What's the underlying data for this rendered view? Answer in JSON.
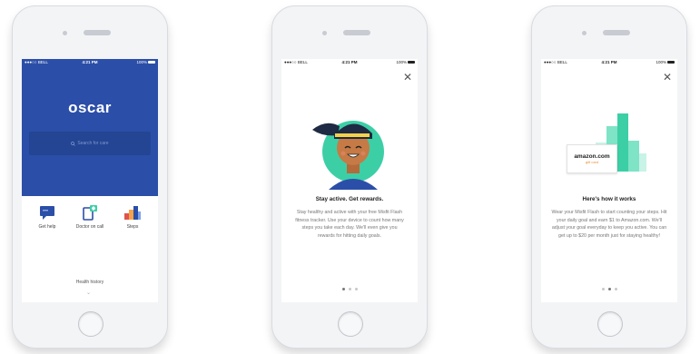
{
  "status_bar": {
    "carrier": "BELL",
    "time": "4:21 PM",
    "battery": "100%"
  },
  "home_screen": {
    "logo": "oscar",
    "search_placeholder": "Search for care",
    "tiles": [
      {
        "label": "Get help",
        "icon": "chat-icon"
      },
      {
        "label": "Doctor on call",
        "icon": "phone-call-icon"
      },
      {
        "label": "Steps",
        "icon": "steps-chart-icon"
      }
    ],
    "footer_link": "Health history"
  },
  "onboarding_1": {
    "title": "Stay active. Get rewards.",
    "body": "Stay healthy and active with your free Misfit Flash fitness tracker. Use your device to count how many steps you take each day. We'll even give you rewards for hitting daily goals.",
    "active_dot": 0
  },
  "onboarding_2": {
    "gift_card_brand": "amazon.com",
    "gift_card_sub": "gift card",
    "title": "Here's how it works",
    "body": "Wear your Misfit Flash to start counting your steps. Hit your daily goal and earn $1 to Amazon.com. We'll adjust your goal everyday to keep you active. You can get up to $20 per month just for staying healthy!",
    "active_dot": 1
  },
  "colors": {
    "brand_blue": "#2b4fa8",
    "teal": "#3ccfa6"
  }
}
